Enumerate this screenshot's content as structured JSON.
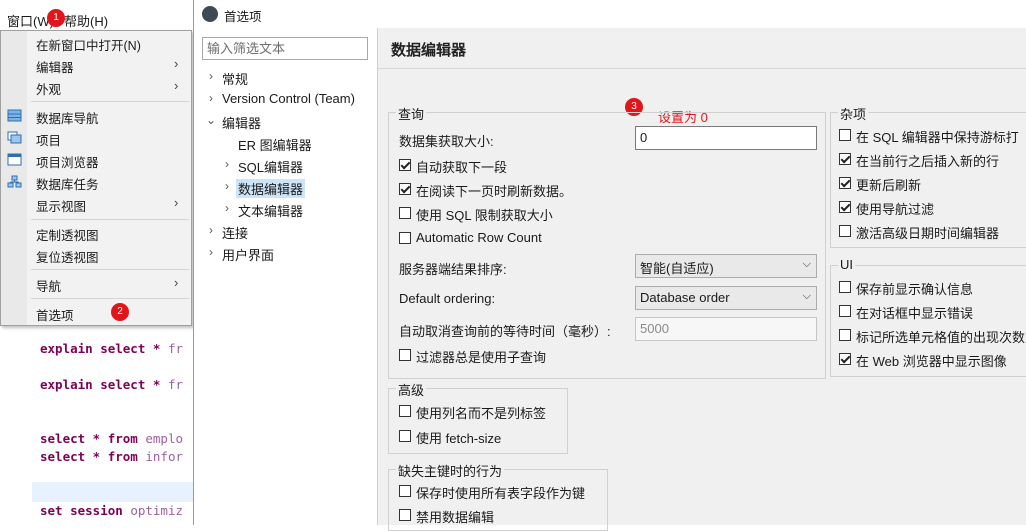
{
  "editor": {
    "lines": [
      {
        "kw": "explain select *",
        "rest": " fr"
      },
      {
        "kw": "explain select *",
        "rest": " fr"
      },
      {
        "kw": "select * from",
        "rest": " emplo"
      },
      {
        "kw": "select * from",
        "rest": " infor"
      },
      {
        "kw": "set session",
        "rest": " optimiz"
      }
    ]
  },
  "menubar": {
    "window": "窗口(W)",
    "help": "帮助(H)"
  },
  "menu": {
    "items": [
      {
        "label": "在新窗口中打开(N)",
        "submenu": false,
        "icon": ""
      },
      {
        "label": "编辑器",
        "submenu": true,
        "icon": ""
      },
      {
        "label": "外观",
        "submenu": true,
        "icon": ""
      },
      {
        "label": "数据库导航",
        "submenu": false,
        "icon": "database-navigator-icon"
      },
      {
        "label": "项目",
        "submenu": false,
        "icon": "projects-icon"
      },
      {
        "label": "项目浏览器",
        "submenu": false,
        "icon": "project-explorer-icon"
      },
      {
        "label": "数据库任务",
        "submenu": false,
        "icon": "database-tasks-icon"
      },
      {
        "label": "显示视图",
        "submenu": true,
        "icon": ""
      },
      {
        "label": "定制透视图",
        "submenu": false,
        "icon": ""
      },
      {
        "label": "复位透视图",
        "submenu": false,
        "icon": ""
      },
      {
        "label": "导航",
        "submenu": true,
        "icon": ""
      },
      {
        "label": "首选项",
        "submenu": false,
        "icon": ""
      }
    ]
  },
  "badges": [
    "1",
    "2",
    "3"
  ],
  "dialog": {
    "title": "首选项",
    "filter_placeholder": "输入筛选文本",
    "tree": {
      "general": "常规",
      "vcs": "Version Control (Team)",
      "editors": "编辑器",
      "er": "ER 图编辑器",
      "sql": "SQL编辑器",
      "data": "数据编辑器",
      "text": "文本编辑器",
      "connections": "连接",
      "ui": "用户界面"
    },
    "page_title": "数据编辑器",
    "annotation": "设置为 0",
    "query": {
      "title": "查询",
      "fetch_size_label": "数据集获取大小:",
      "fetch_size_value": "0",
      "auto_fetch": {
        "label": "自动获取下一段",
        "checked": true
      },
      "refresh_on_next": {
        "label": "在阅读下一页时刷新数据。",
        "checked": true
      },
      "sql_limit": {
        "label": "使用 SQL 限制获取大小",
        "checked": false
      },
      "row_count": {
        "label": "Automatic Row Count",
        "checked": false
      },
      "server_sort_label": "服务器端结果排序:",
      "server_sort_value": "智能(自适应)",
      "default_order_label": "Default ordering:",
      "default_order_value": "Database order",
      "cancel_wait_label": "自动取消查询前的等待时间（毫秒）:",
      "cancel_wait_value": "5000",
      "filter_subquery": {
        "label": "过滤器总是使用子查询",
        "checked": false
      }
    },
    "advanced": {
      "title": "高级",
      "col_names": {
        "label": "使用列名而不是列标签",
        "checked": false
      },
      "fetch_size": {
        "label": "使用 fetch-size",
        "checked": false
      }
    },
    "missing_key": {
      "title": "缺失主键时的行为",
      "all_cols": {
        "label": "保存时使用所有表字段作为键",
        "checked": false
      },
      "disable_edit": {
        "label": "禁用数据编辑",
        "checked": false
      }
    },
    "misc": {
      "title": "杂项",
      "keep_cursor": {
        "label": "在 SQL 编辑器中保持游标打",
        "checked": false
      },
      "insert_after": {
        "label": "在当前行之后插入新的行",
        "checked": true
      },
      "refresh_after": {
        "label": "更新后刷新",
        "checked": true
      },
      "nav_filter": {
        "label": "使用导航过滤",
        "checked": true
      },
      "adv_date": {
        "label": "激活高级日期时间编辑器",
        "checked": false
      }
    },
    "ui_group": {
      "title": "UI",
      "confirm_save": {
        "label": "保存前显示确认信息",
        "checked": false
      },
      "show_errors": {
        "label": "在对话框中显示错误",
        "checked": false
      },
      "mark_count": {
        "label": "标记所选单元格值的出现次数",
        "checked": false
      },
      "web_images": {
        "label": "在 Web 浏览器中显示图像",
        "checked": true
      }
    }
  },
  "colors": {
    "badge": "#e0161b",
    "selection": "#cce4f7",
    "keyword": "#7f0055"
  }
}
